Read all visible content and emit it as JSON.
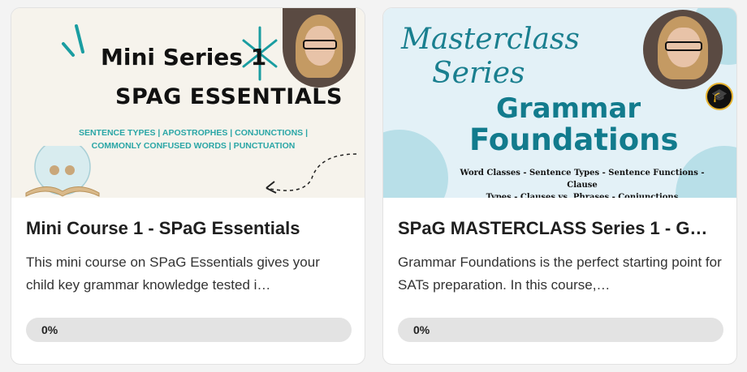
{
  "courses": [
    {
      "thumbnail": {
        "heading_line1": "Mini Series 1",
        "heading_line2": "SPAG ESSENTIALS",
        "topics_line1": "SENTENCE TYPES | APOSTROPHES | CONJUNCTIONS |",
        "topics_line2": "COMMONLY CONFUSED WORDS | PUNCTUATION"
      },
      "title": "Mini Course 1 - SPaG Essentials",
      "description": "This mini course on SPaG Essentials gives your child key grammar knowledge tested i…",
      "progress_label": "0%",
      "progress_value": 0
    },
    {
      "thumbnail": {
        "script_line1": "Masterclass",
        "script_line2": "Series",
        "heading_line1": "Grammar",
        "heading_line2": "Foundations",
        "topics_line1": "Word Classes - Sentence Types - Sentence Functions - Clause",
        "topics_line2": "Types - Clauses vs. Phrases - Conjunctions",
        "badge_icon": "graduation-cap-icon"
      },
      "title": "SPaG MASTERCLASS Series 1 - G…",
      "description": "Grammar Foundations is the perfect starting point for SATs preparation. In this course,…",
      "progress_label": "0%",
      "progress_value": 0
    }
  ],
  "colors": {
    "accent_teal": "#127b8d",
    "topic_teal": "#2aa6a6",
    "progress_track": "#e3e3e3"
  }
}
